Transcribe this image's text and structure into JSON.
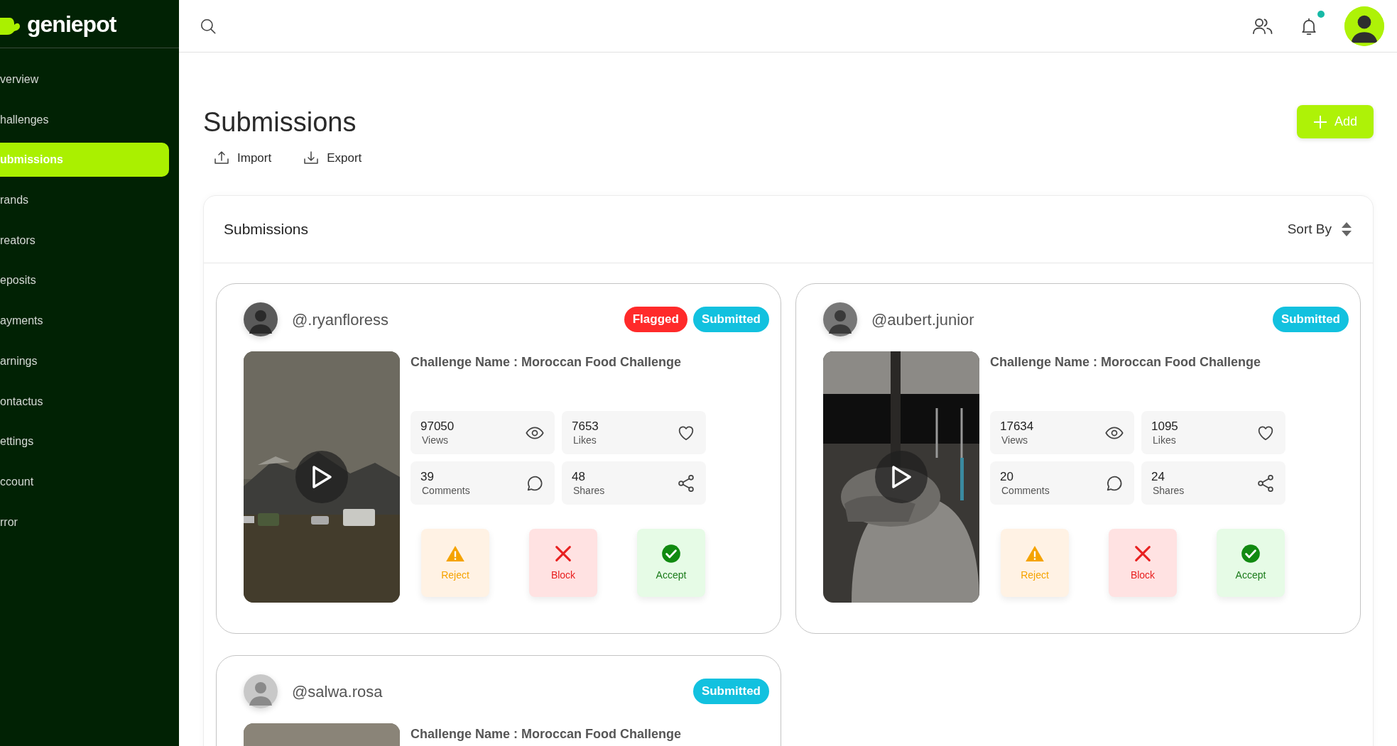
{
  "brand": {
    "name": "geniepot"
  },
  "sidebar": {
    "items": [
      {
        "label": "verview",
        "selected": false
      },
      {
        "label": "hallenges",
        "selected": false
      },
      {
        "label": "ubmissions",
        "selected": true
      },
      {
        "label": "rands",
        "selected": false
      },
      {
        "label": "reators",
        "selected": false
      },
      {
        "label": "eposits",
        "selected": false
      },
      {
        "label": "ayments",
        "selected": false
      },
      {
        "label": "arnings",
        "selected": false
      },
      {
        "label": "ontactus",
        "selected": false
      },
      {
        "label": "ettings",
        "selected": false
      },
      {
        "label": "ccount",
        "selected": false
      },
      {
        "label": "rror",
        "selected": false
      }
    ]
  },
  "topbar": {
    "notifications_unread": true
  },
  "page": {
    "title": "Submissions",
    "add_button": "Add",
    "tools": [
      {
        "label": "Import",
        "kind": "import"
      },
      {
        "label": "Export",
        "kind": "export"
      }
    ]
  },
  "panel": {
    "title": "Submissions",
    "sort_label": "Sort By",
    "cards": [
      {
        "username": "@.ryanfloress",
        "play_button": true,
        "badges": [
          {
            "label": "Flagged",
            "kind": "flagged"
          },
          {
            "label": "Submitted",
            "kind": "submitted"
          }
        ],
        "challenge": "Challenge Name : Moroccan Food Challenge",
        "stats": [
          {
            "value": "97050",
            "label": "Views",
            "kind": "views"
          },
          {
            "value": "7653",
            "label": "Likes",
            "kind": "likes"
          },
          {
            "value": "39",
            "label": "Comments",
            "kind": "comments"
          },
          {
            "value": "48",
            "label": "Shares",
            "kind": "shares"
          }
        ],
        "actions": [
          {
            "label": "Reject",
            "kind": "reject"
          },
          {
            "label": "Block",
            "kind": "block"
          },
          {
            "label": "Accept",
            "kind": "accept"
          }
        ]
      },
      {
        "username": "@aubert.junior",
        "play_button": true,
        "badges": [
          {
            "label": "Submitted",
            "kind": "submitted"
          }
        ],
        "challenge": "Challenge Name : Moroccan Food Challenge",
        "stats": [
          {
            "value": "17634",
            "label": "Views",
            "kind": "views"
          },
          {
            "value": "1095",
            "label": "Likes",
            "kind": "likes"
          },
          {
            "value": "20",
            "label": "Comments",
            "kind": "comments"
          },
          {
            "value": "24",
            "label": "Shares",
            "kind": "shares"
          }
        ],
        "actions": [
          {
            "label": "Reject",
            "kind": "reject"
          },
          {
            "label": "Block",
            "kind": "block"
          },
          {
            "label": "Accept",
            "kind": "accept"
          }
        ]
      },
      {
        "username": "@salwa.rosa",
        "badges": [
          {
            "label": "Submitted",
            "kind": "submitted"
          }
        ],
        "challenge": "Challenge Name : Moroccan Food Challenge"
      }
    ]
  }
}
